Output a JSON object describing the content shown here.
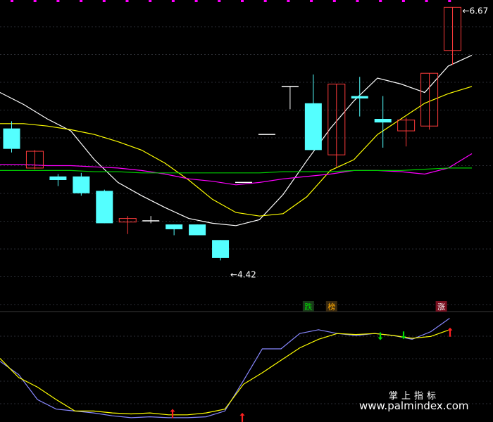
{
  "chart_data": {
    "type": "candlestick",
    "title": "",
    "price_axis": {
      "ylim": [
        4.2,
        6.75
      ],
      "grid": true
    },
    "candles": [
      {
        "open": 5.65,
        "close": 5.48,
        "high": 5.71,
        "low": 5.45
      },
      {
        "open": 5.32,
        "close": 5.46,
        "high": 5.47,
        "low": 5.31
      },
      {
        "open": 5.25,
        "close": 5.22,
        "high": 5.27,
        "low": 5.17
      },
      {
        "open": 5.25,
        "close": 5.11,
        "high": 5.28,
        "low": 5.09
      },
      {
        "open": 5.13,
        "close": 4.86,
        "high": 5.14,
        "low": 4.86
      },
      {
        "open": 4.87,
        "close": 4.9,
        "high": 4.92,
        "low": 4.77
      },
      {
        "open": 4.88,
        "close": 4.88,
        "high": 4.92,
        "low": 4.86
      },
      {
        "open": 4.85,
        "close": 4.81,
        "high": 4.85,
        "low": 4.76
      },
      {
        "open": 4.85,
        "close": 4.76,
        "high": 4.85,
        "low": 4.76
      },
      {
        "open": 4.72,
        "close": 4.57,
        "high": 4.72,
        "low": 4.55
      },
      {
        "open": 5.2,
        "close": 5.2,
        "high": 5.2,
        "low": 5.2
      },
      {
        "open": 5.6,
        "close": 5.6,
        "high": 5.6,
        "low": 5.6
      },
      {
        "open": 6.0,
        "close": 6.0,
        "high": 6.0,
        "low": 5.81
      },
      {
        "open": 5.86,
        "close": 5.47,
        "high": 6.1,
        "low": 5.47
      },
      {
        "open": 5.43,
        "close": 6.02,
        "high": 6.02,
        "low": 5.33
      },
      {
        "open": 5.92,
        "close": 5.9,
        "high": 6.08,
        "low": 5.75
      },
      {
        "open": 5.73,
        "close": 5.7,
        "high": 5.92,
        "low": 5.49
      },
      {
        "open": 5.63,
        "close": 5.72,
        "high": 5.74,
        "low": 5.5
      },
      {
        "open": 5.67,
        "close": 6.11,
        "high": 6.11,
        "low": 5.64
      },
      {
        "open": 6.3,
        "close": 6.66,
        "high": 6.66,
        "low": 6.18
      }
    ],
    "overlays": [
      {
        "color": "#ffffff",
        "values": [
          5.95,
          5.85,
          5.73,
          5.63,
          5.39,
          5.2,
          5.09,
          4.99,
          4.9,
          4.86,
          4.84,
          4.89,
          5.1,
          5.38,
          5.65,
          5.88,
          6.07,
          6.02,
          5.95,
          6.17,
          6.26
        ]
      },
      {
        "color": "#ffff00",
        "values": [
          5.69,
          5.69,
          5.67,
          5.64,
          5.6,
          5.54,
          5.47,
          5.36,
          5.22,
          5.06,
          4.95,
          4.92,
          4.94,
          5.08,
          5.3,
          5.39,
          5.6,
          5.73,
          5.86,
          5.94,
          6.0
        ]
      },
      {
        "color": "#ff00ff",
        "values": [
          5.35,
          5.35,
          5.34,
          5.34,
          5.33,
          5.32,
          5.3,
          5.27,
          5.23,
          5.21,
          5.18,
          5.2,
          5.23,
          5.25,
          5.27,
          5.3,
          5.3,
          5.29,
          5.27,
          5.32,
          5.44
        ]
      },
      {
        "color": "#00cc00",
        "values": [
          5.3,
          5.3,
          5.3,
          5.3,
          5.29,
          5.29,
          5.28,
          5.28,
          5.28,
          5.28,
          5.28,
          5.28,
          5.29,
          5.29,
          5.29,
          5.3,
          5.3,
          5.3,
          5.31,
          5.32,
          5.32
        ]
      }
    ],
    "price_annotations": [
      {
        "candle": 19,
        "text": "6.67"
      },
      {
        "candle": 9,
        "text": "4.42"
      }
    ],
    "markers": [
      {
        "candle": 13,
        "text": "跌",
        "color": "#00dd00",
        "bg": "#1a3a1a"
      },
      {
        "candle": 14,
        "text": "榜",
        "color": "#ffaa00",
        "bg": "#3a2a10"
      },
      {
        "candle": 18,
        "text": "涨",
        "color": "#ffffff",
        "bg": "#7a1020"
      }
    ],
    "indicator": {
      "ylim": [
        0,
        100
      ],
      "line_a": {
        "color": "#8888ff",
        "values": [
          62,
          48,
          22,
          12,
          10,
          8,
          5,
          3,
          4,
          3,
          3,
          4,
          10,
          42,
          75,
          75,
          91,
          95,
          91,
          89,
          91,
          89,
          85,
          93,
          107
        ]
      },
      "line_b": {
        "color": "#ffff00",
        "values": [
          65,
          45,
          35,
          22,
          10,
          10,
          8,
          7,
          8,
          6,
          6,
          8,
          12,
          38,
          50,
          63,
          76,
          85,
          91,
          90,
          91,
          89,
          86,
          88,
          95
        ]
      },
      "up_arrows": [
        5,
        10,
        25
      ],
      "down_arrows": [
        19,
        20
      ]
    }
  },
  "watermark": {
    "brand": "掌上指标",
    "url": "www.palmindex.com"
  }
}
